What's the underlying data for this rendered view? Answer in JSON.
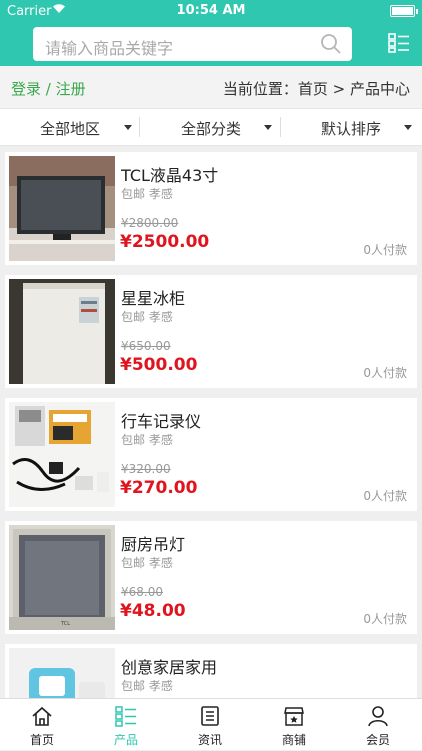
{
  "status_bar": {
    "carrier": "Carrier",
    "time": "10:54 AM"
  },
  "search": {
    "placeholder": "请输入商品关键字"
  },
  "auth": {
    "login": "登录",
    "divider": "/",
    "register": "注册"
  },
  "breadcrumb": {
    "prefix": "当前位置：",
    "home": "首页",
    "sep": ">",
    "current": "产品中心"
  },
  "filters": [
    {
      "label": "全部地区"
    },
    {
      "label": "全部分类"
    },
    {
      "label": "默认排序"
    }
  ],
  "products": [
    {
      "title": "TCL液晶43寸",
      "shipping": "包邮",
      "location": "孝感",
      "old_price": "¥2800.00",
      "price": "¥2500.00",
      "sold": "0人付款"
    },
    {
      "title": "星星冰柜",
      "shipping": "包邮",
      "location": "孝感",
      "old_price": "¥650.00",
      "price": "¥500.00",
      "sold": "0人付款"
    },
    {
      "title": "行车记录仪",
      "shipping": "包邮",
      "location": "孝感",
      "old_price": "¥320.00",
      "price": "¥270.00",
      "sold": "0人付款"
    },
    {
      "title": "厨房吊灯",
      "shipping": "包邮",
      "location": "孝感",
      "old_price": "¥68.00",
      "price": "¥48.00",
      "sold": "0人付款"
    },
    {
      "title": "创意家居家用",
      "shipping": "包邮",
      "location": "孝感",
      "old_price": "",
      "price": "",
      "sold": ""
    }
  ],
  "tabs": [
    {
      "label": "首页",
      "icon": "home-icon"
    },
    {
      "label": "产品",
      "icon": "product-list-icon",
      "active": true
    },
    {
      "label": "资讯",
      "icon": "news-icon"
    },
    {
      "label": "商铺",
      "icon": "shop-icon"
    },
    {
      "label": "会员",
      "icon": "member-icon"
    }
  ],
  "colors": {
    "accent": "#2fc7b0",
    "price": "#e0141e",
    "login": "#3aa84c"
  }
}
